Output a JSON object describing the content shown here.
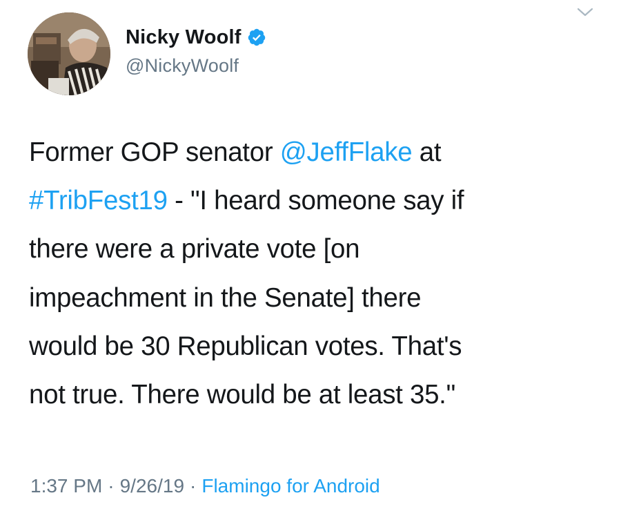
{
  "author": {
    "display_name": "Nicky Woolf",
    "handle": "@NickyWoolf",
    "verified": true,
    "avatar_icon": "profile-photo"
  },
  "tweet": {
    "lines": [
      [
        {
          "text": "Former GOP senator ",
          "link": false
        },
        {
          "text": "@JeffFlake",
          "link": true
        },
        {
          "text": " at",
          "link": false
        }
      ],
      [
        {
          "text": "#TribFest19",
          "link": true
        },
        {
          "text": " - \"I heard someone say if",
          "link": false
        }
      ],
      [
        {
          "text": "there were a private vote [on",
          "link": false
        }
      ],
      [
        {
          "text": "impeachment in the Senate] there",
          "link": false
        }
      ],
      [
        {
          "text": "would be 30 Republican votes. That's",
          "link": false
        }
      ],
      [
        {
          "text": "not true. There would be at least 35.\"",
          "link": false
        }
      ]
    ]
  },
  "meta": {
    "time": "1:37 PM",
    "separator": "·",
    "date": "9/26/19",
    "source": "Flamingo for Android"
  },
  "colors": {
    "link": "#1da1f2",
    "text": "#14171a",
    "secondary": "#657786",
    "verified": "#1da1f2"
  },
  "icons": {
    "menu": "chevron-down-icon",
    "verified": "verified-badge-icon"
  }
}
